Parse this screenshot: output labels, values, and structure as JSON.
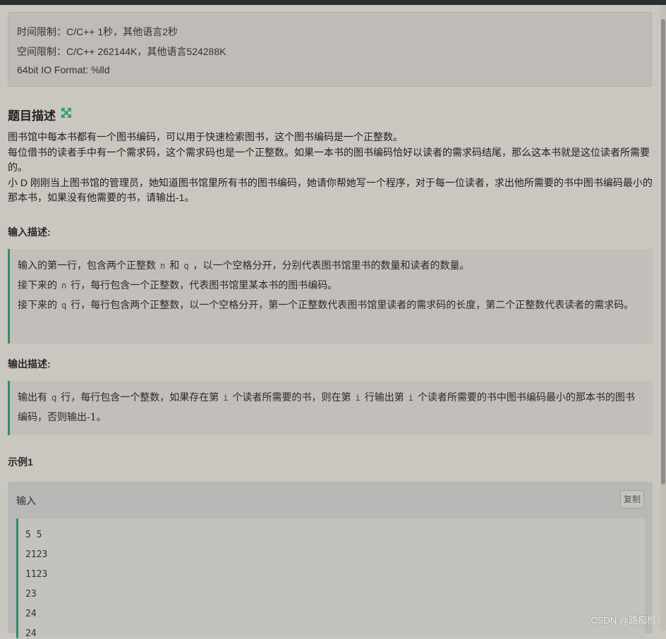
{
  "limits": {
    "time": "时间限制：C/C++ 1秒，其他语言2秒",
    "space": "空间限制：C/C++ 262144K，其他语言524288K",
    "io": "64bit IO Format: %lld"
  },
  "problem": {
    "title": "题目描述",
    "title_icon": "expand-icon",
    "description": [
      "图书馆中每本书都有一个图书编码，可以用于快速检索图书，这个图书编码是一个正整数。",
      "每位借书的读者手中有一个需求码，这个需求码也是一个正整数。如果一本书的图书编码恰好以读者的需求码结尾，那么这本书就是这位读者所需要的。",
      "小 D 刚刚当上图书馆的管理员，她知道图书馆里所有书的图书编码，她请你帮她写一个程序，对于每一位读者，求出他所需要的书中图书编码最小的那本书，如果没有他需要的书，请输出-1。"
    ]
  },
  "input_section": {
    "title": "输入描述:",
    "line1": {
      "a": "输入的第一行，包含两个正整数",
      "v1": "n",
      "b": "和",
      "v2": "q",
      "c": "，以一个空格分开，分别代表图书馆里书的数量和读者的数量。"
    },
    "line2": {
      "a": "接下来的",
      "v1": "n",
      "b": "行，每行包含一个正整数，代表图书馆里某本书的图书编码。"
    },
    "line3": {
      "a": "接下来的",
      "v1": "q",
      "b": "行，每行包含两个正整数，以一个空格分开，第一个正整数代表图书馆里读者的需求码的长度，第二个正整数代表读者的需求码。"
    }
  },
  "output_section": {
    "title": "输出描述:",
    "line": {
      "a": "输出有",
      "v1": "q",
      "b": "行，每行包含一个整数，如果存在第",
      "v2": "i",
      "c": "个读者所需要的书，则在第",
      "v3": "i",
      "d": "行输出第",
      "v4": "i",
      "e": "个读者所需要的书中图书编码最小的那本书的图书编码，否则输出-1。"
    }
  },
  "example": {
    "title": "示例1",
    "input_label": "输入",
    "copy_label": "复制",
    "lines": [
      "5 5",
      "2123",
      "1123",
      "23",
      "24",
      "24"
    ]
  },
  "watermark": "CSDN @路痴楷",
  "colors": {
    "accent": "#2e8f6a",
    "background": "#cac7c1"
  }
}
